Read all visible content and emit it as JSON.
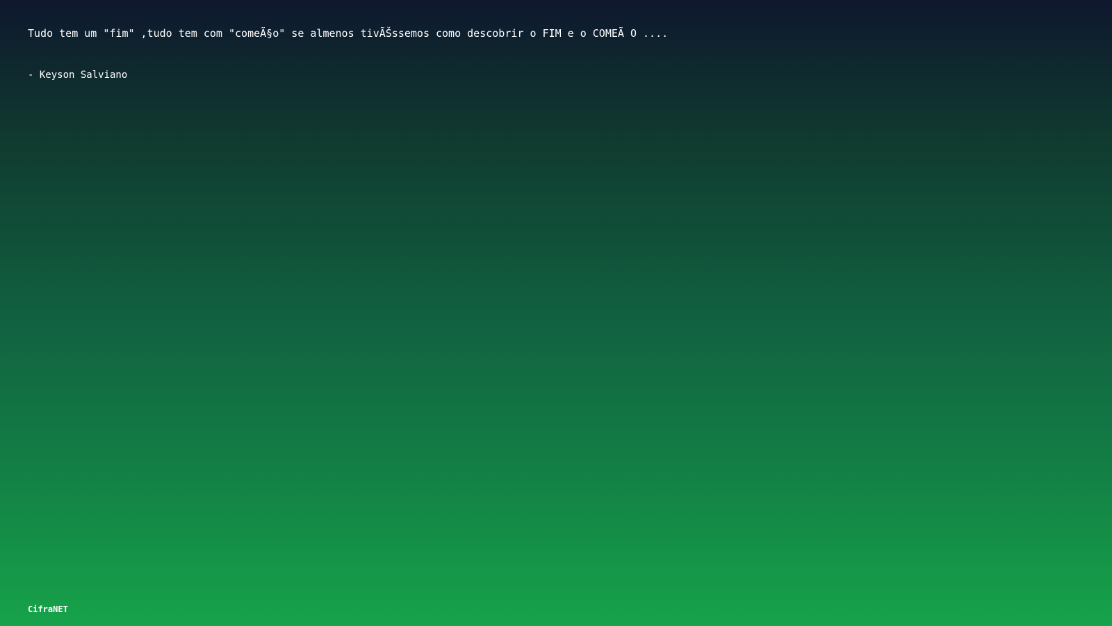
{
  "quote": {
    "text": "Tudo tem um \"fim\" ,tudo tem com \"comeÃ§o\" se almenos tivÃŠssemos como descobrir o FIM e o COMEÃ O ....",
    "author": "- Keyson Salviano"
  },
  "footer": {
    "brand": "CifraNET"
  }
}
